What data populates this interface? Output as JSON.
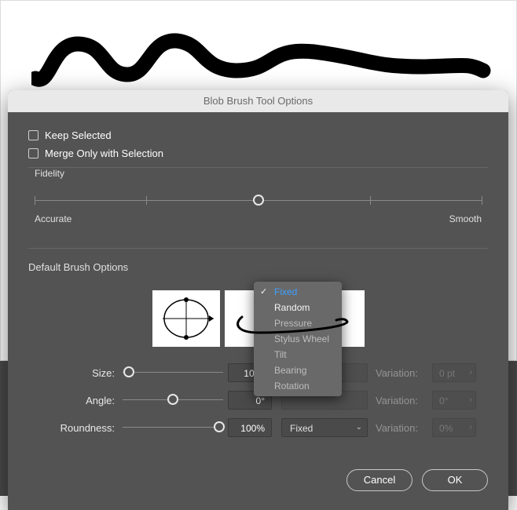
{
  "dialog_title": "Blob Brush Tool Options",
  "checkboxes": {
    "keep_selected": "Keep Selected",
    "merge_only": "Merge Only with Selection"
  },
  "fidelity": {
    "label": "Fidelity",
    "left": "Accurate",
    "right": "Smooth"
  },
  "brush": {
    "title": "Default Brush Options",
    "rows": {
      "size": {
        "label": "Size:",
        "value": "10 pt",
        "variation_label": "Variation:",
        "variation_value": "0 pt"
      },
      "angle": {
        "label": "Angle:",
        "value": "0°",
        "variation_label": "Variation:",
        "variation_value": "0°"
      },
      "roundness": {
        "label": "Roundness:",
        "value": "100%",
        "select_label": "Fixed",
        "variation_label": "Variation:",
        "variation_value": "0%"
      }
    }
  },
  "dropdown": {
    "items": [
      {
        "label": "Fixed",
        "selected": true,
        "enabled": true
      },
      {
        "label": "Random",
        "selected": false,
        "enabled": true
      },
      {
        "label": "Pressure",
        "selected": false,
        "enabled": false
      },
      {
        "label": "Stylus Wheel",
        "selected": false,
        "enabled": false
      },
      {
        "label": "Tilt",
        "selected": false,
        "enabled": false
      },
      {
        "label": "Bearing",
        "selected": false,
        "enabled": false
      },
      {
        "label": "Rotation",
        "selected": false,
        "enabled": false
      }
    ]
  },
  "buttons": {
    "cancel": "Cancel",
    "ok": "OK"
  }
}
